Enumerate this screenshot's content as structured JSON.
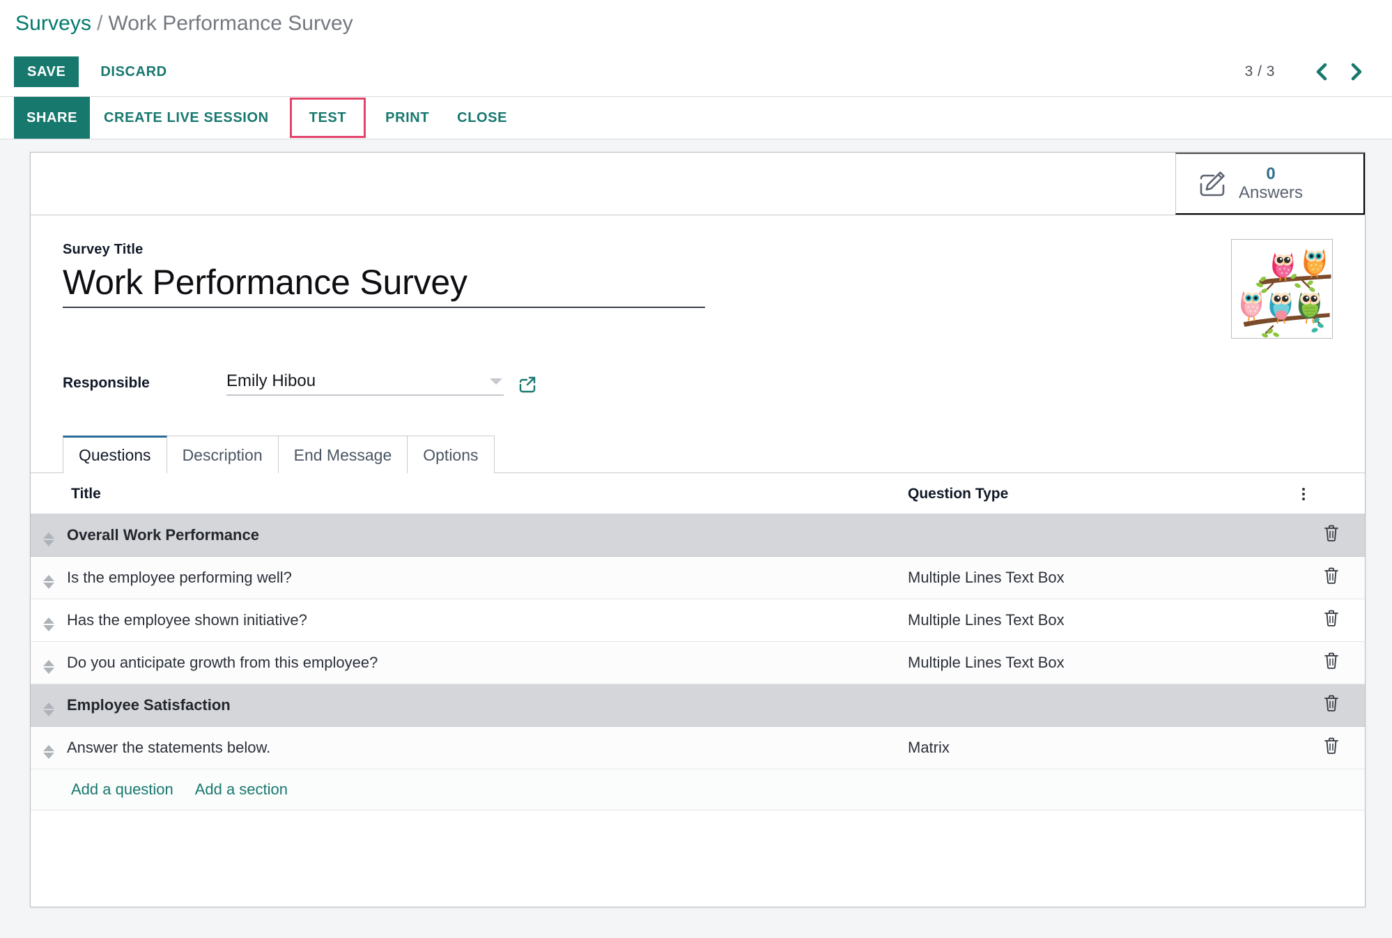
{
  "breadcrumb": {
    "root": "Surveys",
    "separator": "/",
    "current": "Work Performance Survey"
  },
  "controls": {
    "save_label": "SAVE",
    "discard_label": "DISCARD",
    "pager_count": "3 / 3",
    "prev_icon": "chevron-left-icon",
    "next_icon": "chevron-right-icon"
  },
  "actions": [
    {
      "label": "SHARE",
      "style": "primary",
      "highlighted": false
    },
    {
      "label": "CREATE LIVE SESSION",
      "style": "link",
      "highlighted": false
    },
    {
      "label": "TEST",
      "style": "link",
      "highlighted": true
    },
    {
      "label": "PRINT",
      "style": "link",
      "highlighted": false
    },
    {
      "label": "CLOSE",
      "style": "link",
      "highlighted": false
    }
  ],
  "stat_button": {
    "icon": "edit-answers-icon",
    "value": "0",
    "label": "Answers"
  },
  "form": {
    "title_label": "Survey Title",
    "title_value": "Work Performance Survey",
    "responsible_label": "Responsible",
    "responsible_value": "Emily Hibou",
    "image_alt": "five colorful owls on branches"
  },
  "tabs": [
    {
      "label": "Questions",
      "active": true
    },
    {
      "label": "Description",
      "active": false
    },
    {
      "label": "End Message",
      "active": false
    },
    {
      "label": "Options",
      "active": false
    }
  ],
  "questions_table": {
    "headers": {
      "title": "Title",
      "question_type": "Question Type"
    },
    "rows": [
      {
        "kind": "section",
        "title": "Overall Work Performance",
        "question_type": ""
      },
      {
        "kind": "question",
        "title": "Is the employee performing well?",
        "question_type": "Multiple Lines Text Box"
      },
      {
        "kind": "question",
        "title": "Has the employee shown initiative?",
        "question_type": "Multiple Lines Text Box"
      },
      {
        "kind": "question",
        "title": "Do you anticipate growth from this employee?",
        "question_type": "Multiple Lines Text Box"
      },
      {
        "kind": "section",
        "title": "Employee Satisfaction",
        "question_type": ""
      },
      {
        "kind": "question",
        "title": "Answer the statements below.",
        "question_type": "Matrix"
      }
    ],
    "add_question_label": "Add a question",
    "add_section_label": "Add a section",
    "options_icon": "vertical-dots-icon",
    "delete_icon": "trash-icon",
    "handle_icon": "drag-handle-icon"
  },
  "colors": {
    "brand_teal": "#17786e",
    "highlight_pink": "#e3446b",
    "stat_blue": "#31708f",
    "tab_active_border": "#2d6b9a",
    "section_row_bg": "#d5d6d9"
  }
}
